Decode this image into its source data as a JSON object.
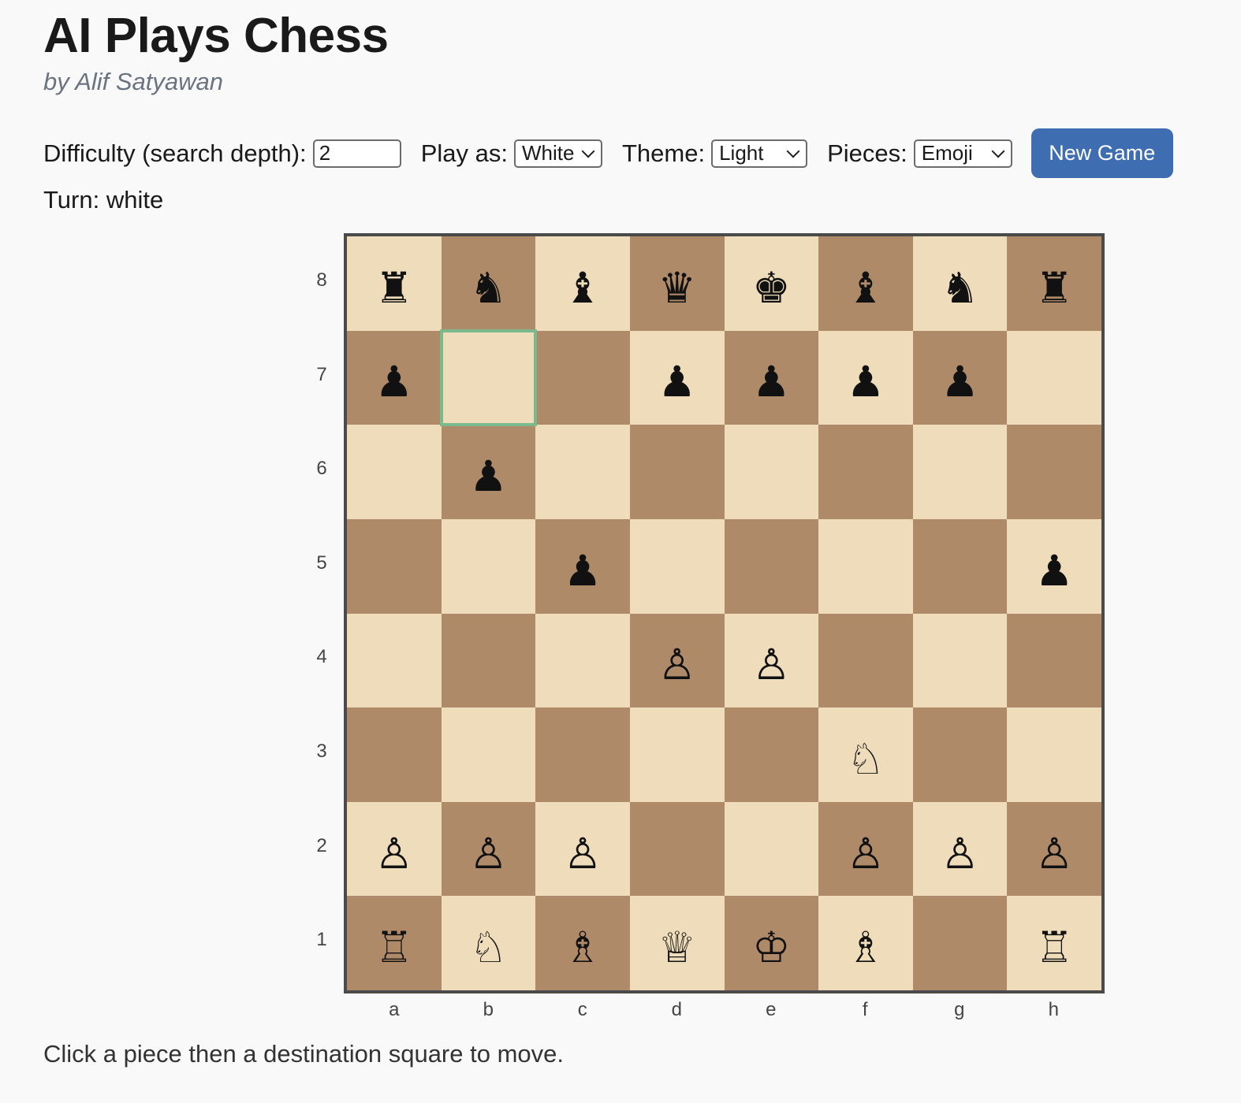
{
  "header": {
    "title": "AI Plays Chess",
    "author": "by Alif Satyawan"
  },
  "controls": {
    "difficulty_label": "Difficulty (search depth):",
    "difficulty_value": "2",
    "play_as_label": "Play as:",
    "play_as_value": "White",
    "theme_label": "Theme:",
    "theme_value": "Light",
    "pieces_label": "Pieces:",
    "pieces_value": "Emoji",
    "new_game_label": "New Game"
  },
  "status": {
    "turn": "Turn: white"
  },
  "colors": {
    "light_square": "#eedcba",
    "dark_square": "#ae8a69",
    "highlight": "#79b98b",
    "button": "#3f6db2"
  },
  "board": {
    "ranks": [
      "8",
      "7",
      "6",
      "5",
      "4",
      "3",
      "2",
      "1"
    ],
    "files": [
      "a",
      "b",
      "c",
      "d",
      "e",
      "f",
      "g",
      "h"
    ],
    "highlighted_square": "b7",
    "rows": [
      [
        "♜",
        "♞",
        "♝",
        "♛",
        "♚",
        "♝",
        "♞",
        "♜"
      ],
      [
        "♟",
        "",
        "",
        "♟",
        "♟",
        "♟",
        "♟",
        ""
      ],
      [
        "",
        "♟",
        "",
        "",
        "",
        "",
        "",
        ""
      ],
      [
        "",
        "",
        "♟",
        "",
        "",
        "",
        "",
        "♟"
      ],
      [
        "",
        "",
        "",
        "♙",
        "♙",
        "",
        "",
        ""
      ],
      [
        "",
        "",
        "",
        "",
        "",
        "♘",
        "",
        ""
      ],
      [
        "♙",
        "♙",
        "♙",
        "",
        "",
        "♙",
        "♙",
        "♙"
      ],
      [
        "♖",
        "♘",
        "♗",
        "♕",
        "♔",
        "♗",
        "",
        "♖"
      ]
    ]
  },
  "footer": {
    "hint": "Click a piece then a destination square to move."
  }
}
